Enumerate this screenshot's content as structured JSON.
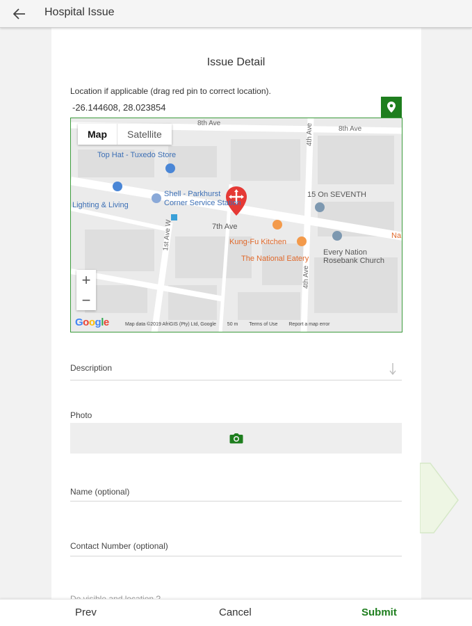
{
  "appbar": {
    "title": "Hospital Issue",
    "back_icon": "arrow-left-icon"
  },
  "form": {
    "heading": "Issue Detail",
    "location_label": "Location if applicable (drag red pin to correct location).",
    "coordinates": "-26.144608, 28.023854",
    "locate_icon": "map-marker-icon",
    "description_label": "Description",
    "photo_label": "Photo",
    "camera_icon": "camera-icon",
    "name_label": "Name (optional)",
    "contact_label": "Contact Number (optional)",
    "partial_label": "Do visible and location ?"
  },
  "map": {
    "type_map": "Map",
    "type_satellite": "Satellite",
    "zoom_in": "+",
    "zoom_out": "−",
    "labels": {
      "top_hat": "Top Hat - Tuxedo Store",
      "shell": "Shell - Parkhurst",
      "shell2": "Corner Service Station",
      "lighting": "Lighting & Living",
      "fifteen": "15 On SEVENTH",
      "seventh_ave": "7th Ave",
      "kungfu": "Kung-Fu Kitchen",
      "national": "The National Eatery",
      "every_nation": "Every Nation",
      "rosebank": "Rosebank Church",
      "eighth_ave": "8th Ave",
      "eighth_ave2": "8th Ave",
      "fourth_ave": "4th Ave",
      "fourth_ave2": "4th Ave",
      "first_ave": "1st Ave W",
      "na": "Na"
    },
    "google": "Google",
    "attribution": "Map data ©2019 AfriGIS (Pty) Ltd, Google",
    "scale": "50 m",
    "terms": "Terms of Use",
    "report": "Report a map error"
  },
  "bottombar": {
    "prev": "Prev",
    "cancel": "Cancel",
    "submit": "Submit"
  },
  "colors": {
    "accent": "#1e7e1e",
    "pin": "#e53935",
    "map_bg": "#e9e9e9"
  }
}
